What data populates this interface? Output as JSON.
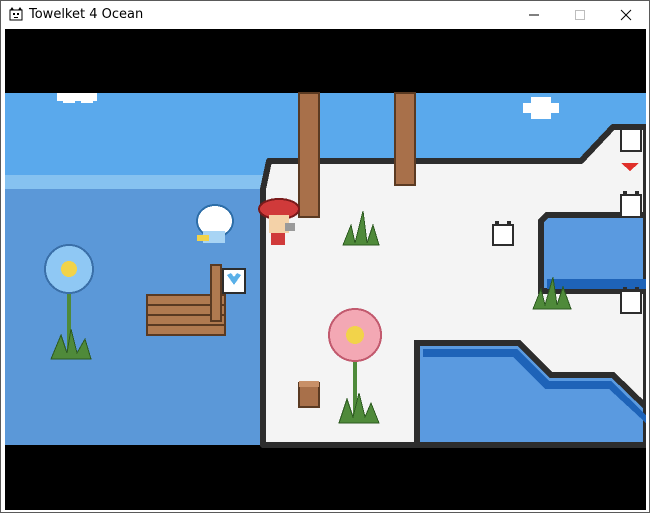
{
  "window": {
    "title": "Towelket 4 Ocean",
    "app_icon": "cat-face-icon",
    "controls": [
      "minimize-icon",
      "maximize-icon",
      "close-icon"
    ]
  },
  "scene": {
    "description_icons": [
      "cloud",
      "sea",
      "island",
      "flower",
      "raft",
      "character",
      "heart-speech-bubble",
      "down-arrow-marker"
    ],
    "colors": {
      "sky": "#5aa9ec",
      "sea": "#5b98d8",
      "island": "#f4f4f4",
      "island_outline": "#2d2d2d",
      "pool": "#5a9ae0",
      "pool_edge": "#1e63b8",
      "wood": "#a8704a",
      "letterbox": "#000000",
      "marker": "#e0302a"
    }
  }
}
